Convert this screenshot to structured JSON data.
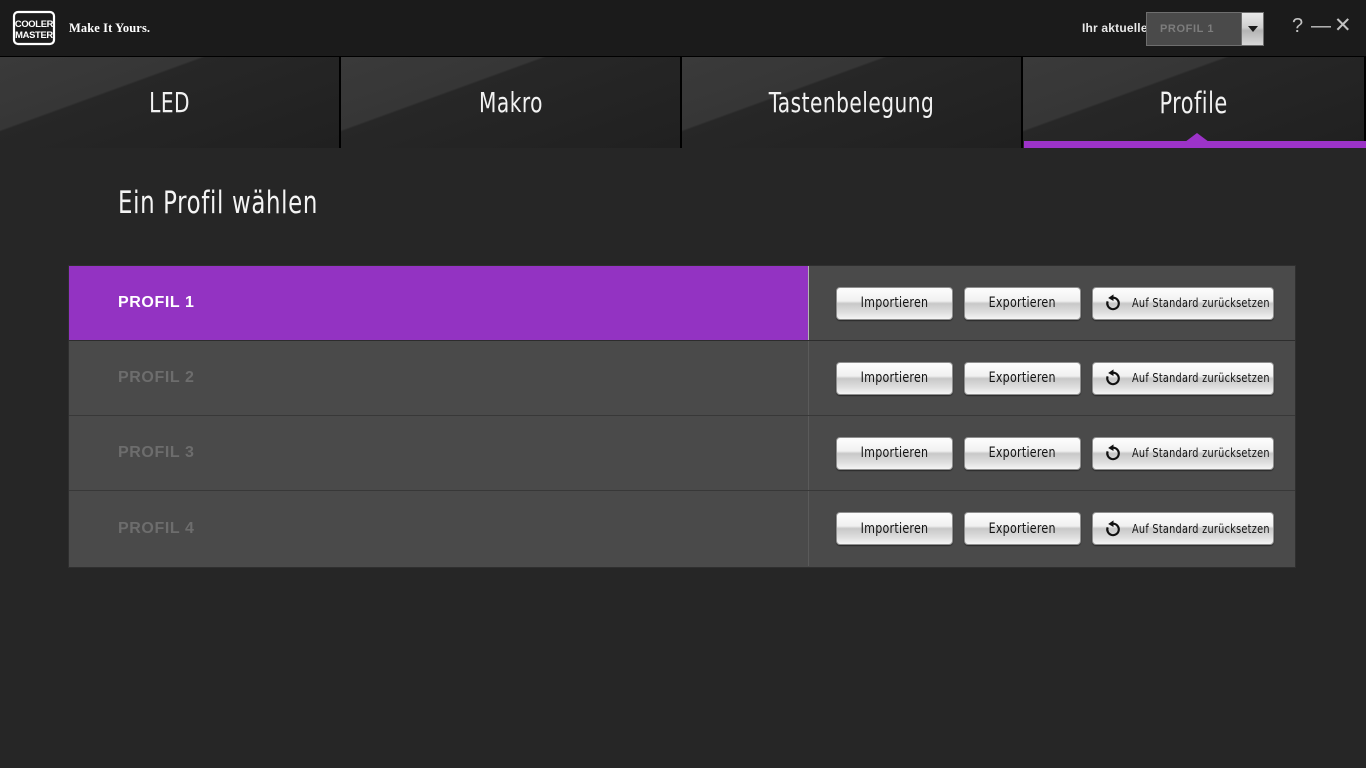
{
  "app": {
    "brand_line1": "COOLER",
    "brand_line2": "MASTER",
    "tagline": "Make It Yours.",
    "accent_color": "#9333c2",
    "background_color": "#262626"
  },
  "titlebar": {
    "current_profile_label": "Ihr aktuelles Profil",
    "profile_select_value": "PROFIL 1",
    "dropdown_icon": "chevron-down-icon",
    "help_icon": "?",
    "minimize_icon": "—",
    "close_icon": "✕"
  },
  "tabs": [
    {
      "id": "led",
      "label": "LED",
      "active": false
    },
    {
      "id": "makro",
      "label": "Makro",
      "active": false
    },
    {
      "id": "tastenbelegung",
      "label": "Tastenbelegung",
      "active": false
    },
    {
      "id": "profile",
      "label": "Profile",
      "active": true
    }
  ],
  "main": {
    "page_title": "Ein Profil wählen",
    "buttons": {
      "import_label": "Importieren",
      "export_label": "Exportieren",
      "reset_label": "Auf Standard zurücksetzen",
      "reset_icon": "undo-arrow-icon"
    },
    "profiles": [
      {
        "name": "PROFIL 1",
        "selected": true
      },
      {
        "name": "PROFIL 2",
        "selected": false
      },
      {
        "name": "PROFIL 3",
        "selected": false
      },
      {
        "name": "PROFIL 4",
        "selected": false
      }
    ]
  }
}
